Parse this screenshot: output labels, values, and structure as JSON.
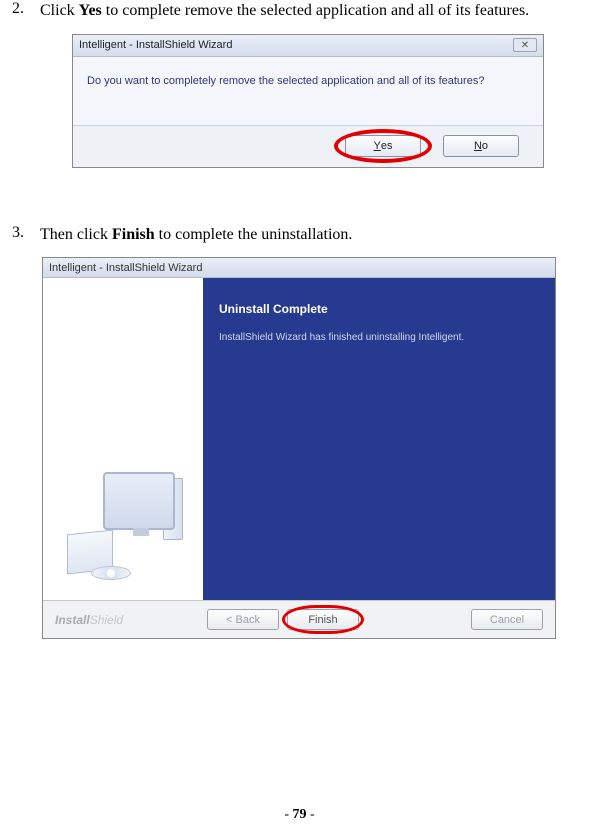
{
  "step2": {
    "num": "2.",
    "prefix": "Click ",
    "bold": "Yes",
    "suffix": " to complete remove the selected application and all of its features."
  },
  "dialog1": {
    "title": "Intelligent - InstallShield Wizard",
    "close_glyph": "✕",
    "message": "Do you want to completely remove the selected application and all of its features?",
    "yes_underline": "Y",
    "yes_rest": "es",
    "no_underline": "N",
    "no_rest": "o"
  },
  "step3": {
    "num": "3.",
    "prefix": "Then click ",
    "bold": "Finish",
    "suffix": " to complete the uninstallation."
  },
  "dialog2": {
    "title": "Intelligent - InstallShield Wizard",
    "heading": "Uninstall Complete",
    "message": "InstallShield Wizard has finished uninstalling Intelligent.",
    "brand_a": "Install",
    "brand_b": "Shield",
    "back": "< Back",
    "finish": "Finish",
    "cancel": "Cancel"
  },
  "page": {
    "dash1": "- ",
    "num": "79",
    "dash2": " -"
  }
}
